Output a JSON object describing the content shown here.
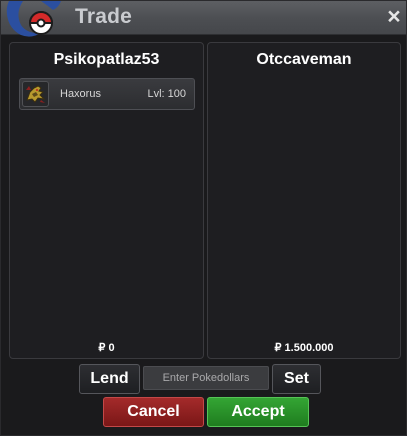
{
  "window": {
    "title": "Trade",
    "close_label": "×"
  },
  "left": {
    "player_name": "Psikopatlaz53",
    "pokemon": [
      {
        "name": "Haxorus",
        "level": "Lvl: 100"
      }
    ],
    "money": "₽ 0"
  },
  "right": {
    "player_name": "Otccaveman",
    "money": "₽ 1.500.000"
  },
  "controls": {
    "lend_label": "Lend",
    "pokedollars_placeholder": "Enter Pokedollars",
    "set_label": "Set",
    "cancel_label": "Cancel",
    "accept_label": "Accept"
  },
  "colors": {
    "cancel": "#8f2020",
    "accept": "#2a942a",
    "panel_bg": "#1e1e21",
    "titlebar": "#4e5054"
  },
  "icons": {
    "app_logo": "pokeball-app-logo-icon",
    "pokemon_icon": "haxorus-sprite-icon",
    "close": "close-icon"
  }
}
